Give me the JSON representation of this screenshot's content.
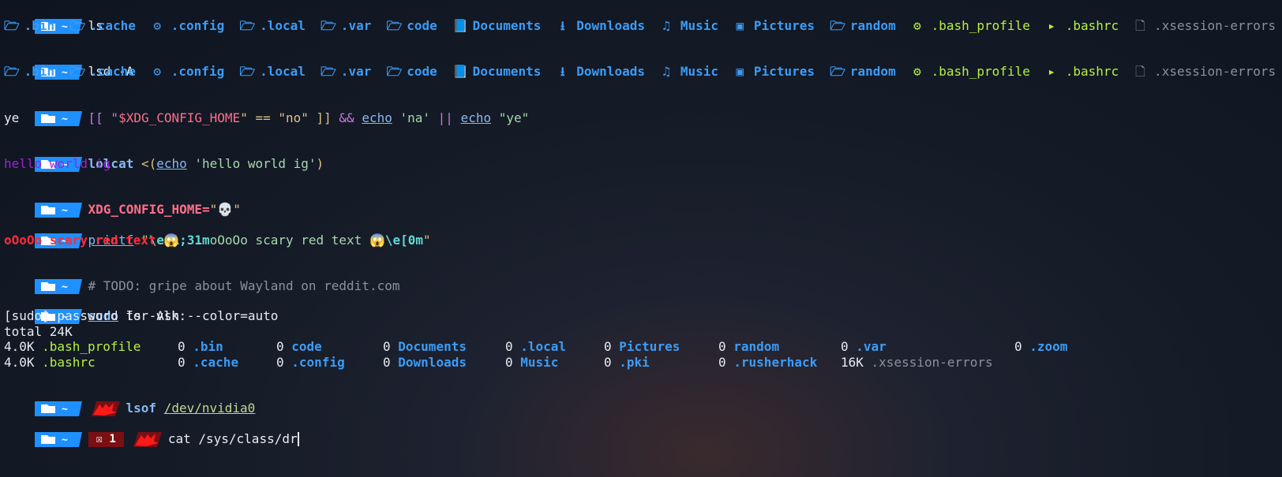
{
  "prompt": {
    "symbol": "~"
  },
  "block1": {
    "cmd": "ls",
    "items": [
      ".bin",
      ".cache",
      ".config",
      ".local",
      ".var",
      "code",
      "Documents",
      "Downloads",
      "Music",
      "Pictures",
      "random",
      ".bash_profile",
      ".bashrc",
      ".xsession-errors"
    ]
  },
  "block2": {
    "cmd": "lsd",
    "arg": "-A"
  },
  "block3": {
    "p1": "[[ \"",
    "var": "$XDG_CONFIG_HOME",
    "p2": "\" == \"no\" ]] ",
    "and": "&&",
    "echo1": "echo",
    "s1": " 'na' ",
    "or": "||",
    "echo2": "echo",
    "s2": " \"ye\"",
    "out": "ye"
  },
  "block4": {
    "cmd": "lolcat",
    "p1": " <(",
    "echo": "echo",
    "s": " 'hello world ig'",
    "close": ")",
    "out": "hello world ig"
  },
  "block5": {
    "var": "XDG_CONFIG_HOME=",
    "val": "\"💀\""
  },
  "block6": {
    "cmd": "printf",
    "q": " \"",
    "esc1": "\\e[1;31m",
    "text": "oOoOo scary red text 😱",
    "esc2": "\\e[0m",
    "q2": "\"",
    "out": "oOoOo scary red text 😱"
  },
  "block7": {
    "comment": "# TODO: gripe about Wayland on reddit.com"
  },
  "block8": {
    "sudo": "sudo",
    "rest": " ls -Ash --color=auto",
    "pw": "[sudo] password for vlk:",
    "total": "total 24K",
    "row1": [
      {
        "size": "4.0K",
        "name": ".bash_profile"
      },
      {
        "size": "0",
        "name": ".bin"
      },
      {
        "size": "0",
        "name": "code"
      },
      {
        "size": "0",
        "name": "Documents"
      },
      {
        "size": "0",
        "name": ".local"
      },
      {
        "size": "0",
        "name": "Pictures"
      },
      {
        "size": "0",
        "name": "random"
      },
      {
        "size": "0",
        "name": ".var"
      },
      {
        "size": "0",
        "name": ".zoom"
      }
    ],
    "row2": [
      {
        "size": "4.0K",
        "name": ".bashrc"
      },
      {
        "size": "0",
        "name": ".cache"
      },
      {
        "size": "0",
        "name": ".config"
      },
      {
        "size": "0",
        "name": "Downloads"
      },
      {
        "size": "0",
        "name": "Music"
      },
      {
        "size": "0",
        "name": ".pki"
      },
      {
        "size": "0",
        "name": ".rusherhack"
      },
      {
        "size": "16K",
        "name": ".xsession-errors"
      }
    ]
  },
  "block9": {
    "cmd": "lsof",
    "arg": "/dev/nvidia0"
  },
  "block10": {
    "err": "1",
    "input": "cat /sys/class/dr"
  },
  "colors": {
    "prompt_bg": "#1e90ff",
    "accent_red": "#ff1a1a",
    "err_bg": "#7a0f14"
  }
}
